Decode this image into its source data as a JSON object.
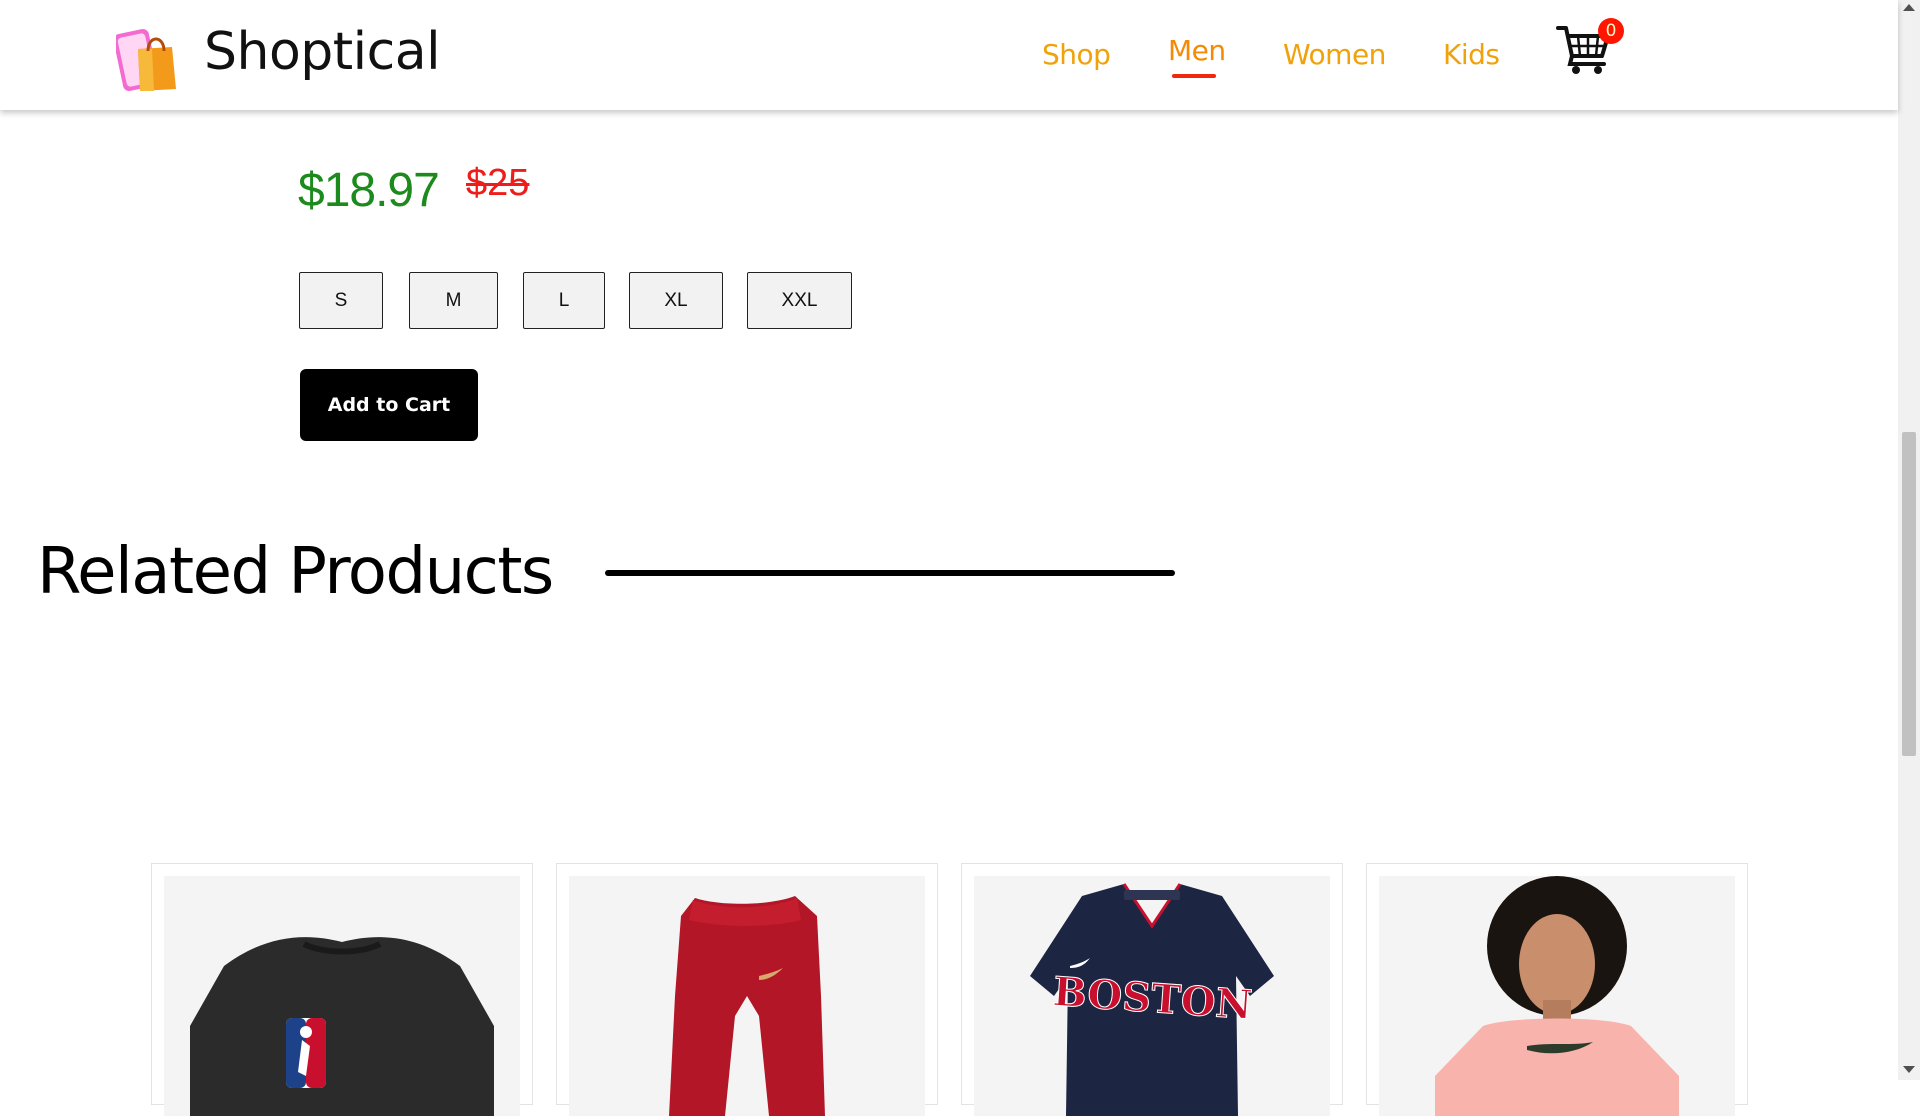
{
  "header": {
    "brand": "Shoptical",
    "nav": [
      {
        "label": "Shop",
        "active": false
      },
      {
        "label": "Men",
        "active": true
      },
      {
        "label": "Women",
        "active": false
      },
      {
        "label": "Kids",
        "active": false
      }
    ],
    "cart_count": "0"
  },
  "product": {
    "price": "$18.97",
    "old_price": "$25",
    "sizes": [
      "S",
      "M",
      "L",
      "XL",
      "XXL"
    ],
    "add_to_cart": "Add to Cart"
  },
  "related": {
    "title": "Related Products",
    "items": [
      {
        "image": "black-nba-tshirt"
      },
      {
        "image": "red-leggings"
      },
      {
        "image": "navy-boston-jersey"
      },
      {
        "image": "pink-tshirt-model"
      }
    ]
  },
  "colors": {
    "nav": "#f0a20a",
    "nav_active_underline": "#f0290d",
    "price": "#1c8a1c",
    "old_price": "#ef1c1c",
    "cart_badge": "#ff1500"
  }
}
